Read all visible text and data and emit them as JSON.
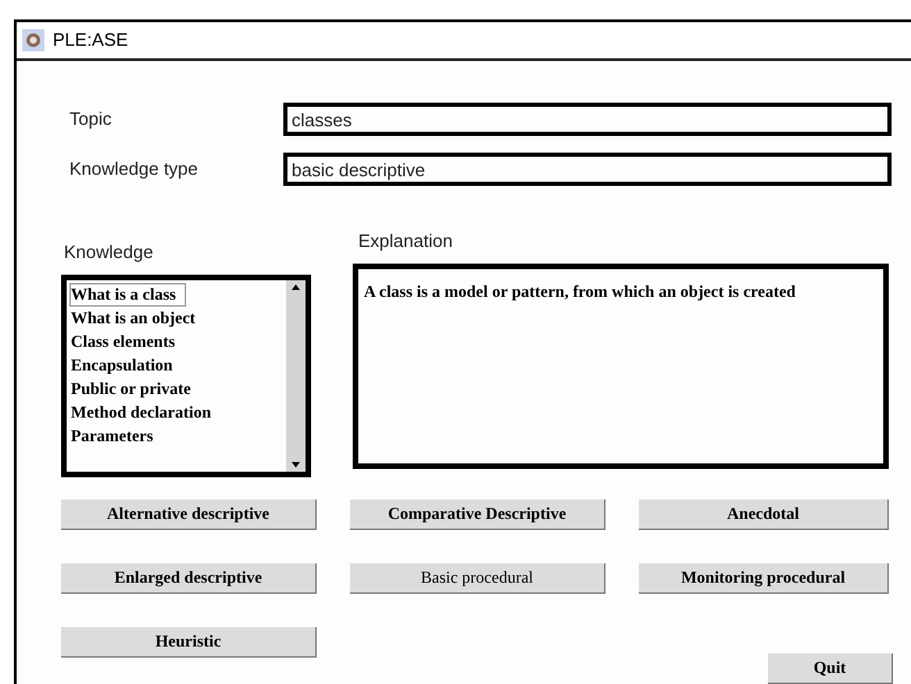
{
  "window": {
    "title": "PLE:ASE"
  },
  "fields": [
    {
      "label": "Topic",
      "value": "classes"
    },
    {
      "label": "Knowledge type",
      "value": "basic descriptive"
    }
  ],
  "knowledge": {
    "label": "Knowledge",
    "items": [
      {
        "text": "What is a class",
        "selected": true
      },
      {
        "text": "What is an object",
        "selected": false
      },
      {
        "text": "Class elements",
        "selected": false
      },
      {
        "text": "Encapsulation",
        "selected": false
      },
      {
        "text": "Public or private",
        "selected": false
      },
      {
        "text": "Method declaration",
        "selected": false
      },
      {
        "text": "Parameters",
        "selected": false
      }
    ]
  },
  "explanation": {
    "label": "Explanation",
    "text": "A class is a model or pattern, from which an object is created"
  },
  "buttons": [
    {
      "label": "Alternative descriptive",
      "bold": true
    },
    {
      "label": "Comparative Descriptive",
      "bold": true
    },
    {
      "label": "Anecdotal",
      "bold": true
    },
    {
      "label": "Enlarged descriptive",
      "bold": true
    },
    {
      "label": "Basic procedural",
      "bold": false
    },
    {
      "label": "Monitoring procedural",
      "bold": true
    },
    {
      "label": "Heuristic",
      "bold": true
    }
  ],
  "quit": "Quit"
}
